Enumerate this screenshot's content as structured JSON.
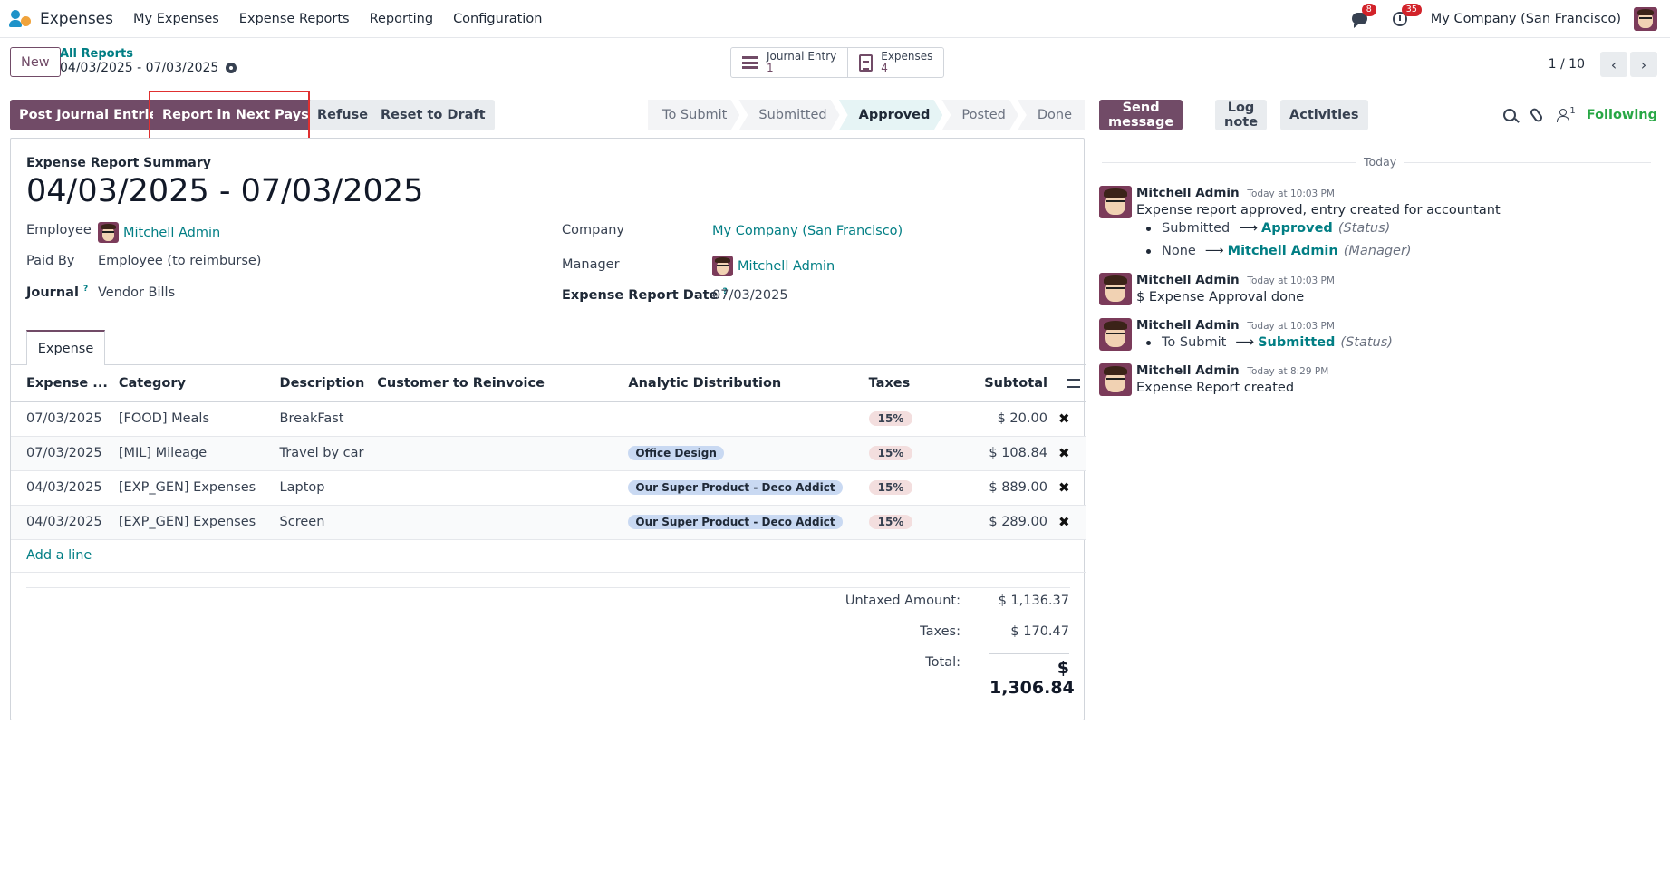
{
  "navbar": {
    "app_name": "Expenses",
    "menu": [
      "My Expenses",
      "Expense Reports",
      "Reporting",
      "Configuration"
    ],
    "messages_badge": "8",
    "activities_badge": "35",
    "company": "My Company (San Francisco)"
  },
  "control": {
    "new_label": "New",
    "breadcrumb_parent": "All Reports",
    "breadcrumb_current": "04/03/2025 - 07/03/2025",
    "smart_buttons": [
      {
        "label": "Journal Entry",
        "value": "1",
        "icon": "list-icon"
      },
      {
        "label": "Expenses",
        "value": "4",
        "icon": "document-icon"
      }
    ],
    "pager_value": "1 / 10"
  },
  "statusbar": {
    "buttons": [
      "Post Journal Entries",
      "Report in Next Payslip",
      "Refuse",
      "Reset to Draft"
    ],
    "stages": [
      "To Submit",
      "Submitted",
      "Approved",
      "Posted",
      "Done"
    ],
    "active_stage": "Approved"
  },
  "form": {
    "summary_label": "Expense Report Summary",
    "title": "04/03/2025 - 07/03/2025",
    "employee_label": "Employee",
    "employee": "Mitchell Admin",
    "paid_by_label": "Paid By",
    "paid_by": "Employee (to reimburse)",
    "journal_label": "Journal",
    "journal": "Vendor Bills",
    "company_label": "Company",
    "company": "My Company (San Francisco)",
    "manager_label": "Manager",
    "manager": "Mitchell Admin",
    "date_label": "Expense Report Date",
    "date": "07/03/2025",
    "help_mark": "?",
    "tab_label": "Expense"
  },
  "table": {
    "headers": [
      "Expense ...",
      "Category",
      "Description",
      "Customer to Reinvoice",
      "Analytic Distribution",
      "Taxes",
      "Subtotal"
    ],
    "rows": [
      {
        "date": "07/03/2025",
        "category": "[FOOD] Meals",
        "description": "BreakFast",
        "customer": "",
        "analytic": "",
        "tax": "15%",
        "subtotal": "$ 20.00"
      },
      {
        "date": "07/03/2025",
        "category": "[MIL] Mileage",
        "description": "Travel by car",
        "customer": "",
        "analytic": "Office Design",
        "tax": "15%",
        "subtotal": "$ 108.84"
      },
      {
        "date": "04/03/2025",
        "category": "[EXP_GEN] Expenses",
        "description": "Laptop",
        "customer": "",
        "analytic": "Our Super Product - Deco Addict",
        "tax": "15%",
        "subtotal": "$ 889.00"
      },
      {
        "date": "04/03/2025",
        "category": "[EXP_GEN] Expenses",
        "description": "Screen",
        "customer": "",
        "analytic": "Our Super Product - Deco Addict",
        "tax": "15%",
        "subtotal": "$ 289.00"
      }
    ],
    "add_line": "Add a line"
  },
  "totals": {
    "untaxed_label": "Untaxed Amount:",
    "untaxed": "$ 1,136.37",
    "taxes_label": "Taxes:",
    "taxes": "$ 170.47",
    "total_label": "Total:",
    "total": "$ 1,306.84"
  },
  "chatter": {
    "send_message": "Send message",
    "log_note": "Log note",
    "activities": "Activities",
    "follower_count": "1",
    "following": "Following",
    "today": "Today",
    "messages": [
      {
        "author": "Mitchell Admin",
        "date": "Today at 10:03 PM",
        "body": "Expense report approved, entry created for accountant",
        "tracking": [
          {
            "old": "Submitted",
            "new": "Approved",
            "field": "(Status)"
          },
          {
            "old": "None",
            "new": "Mitchell Admin",
            "field": "(Manager)"
          }
        ]
      },
      {
        "author": "Mitchell Admin",
        "date": "Today at 10:03 PM",
        "body": "$ Expense Approval done"
      },
      {
        "author": "Mitchell Admin",
        "date": "Today at 10:03 PM",
        "tracking": [
          {
            "old": "To Submit",
            "new": "Submitted",
            "field": "(Status)"
          }
        ]
      },
      {
        "author": "Mitchell Admin",
        "date": "Today at 8:29 PM",
        "body": "Expense Report created"
      }
    ]
  },
  "colors": {
    "primary": "#714b67",
    "link": "#017e84",
    "highlight": "#e03030",
    "following": "#28a745"
  }
}
